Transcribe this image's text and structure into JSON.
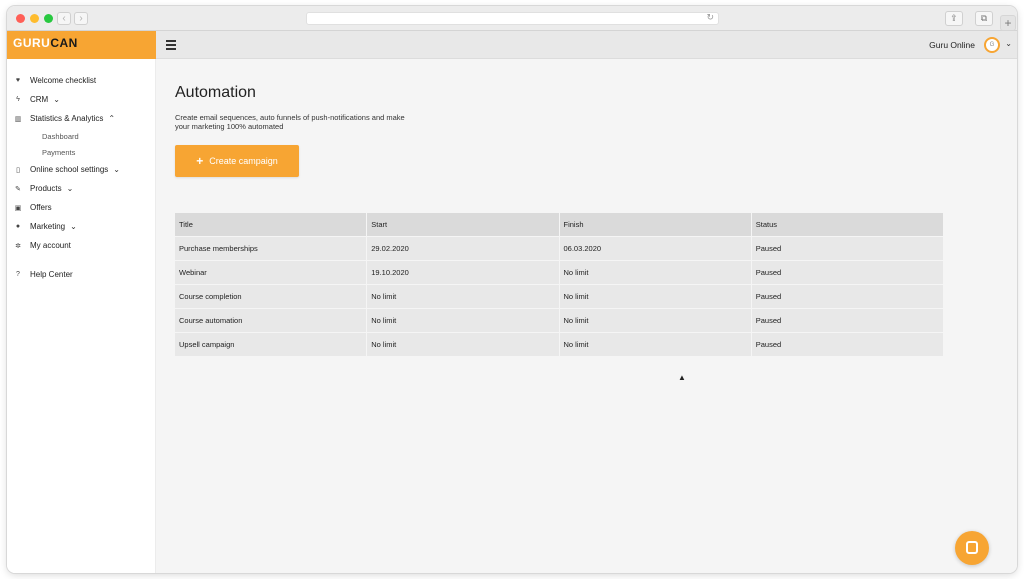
{
  "browser": {
    "back_glyph": "‹",
    "forward_glyph": "›",
    "reload_glyph": "↻",
    "share_glyph": "⇪",
    "tabs_glyph": "⧉",
    "new_tab_glyph": "+"
  },
  "brand": {
    "logo_left": "GURU",
    "logo_right": "CAN",
    "accent_color": "#f7a533"
  },
  "sidebar": {
    "items": [
      {
        "label": "Welcome checklist",
        "icon": "heart-icon",
        "glyph": "♥",
        "chevron": ""
      },
      {
        "label": "CRM",
        "icon": "bolt-icon",
        "glyph": "ϟ",
        "chevron": "⌄"
      },
      {
        "label": "Statistics & Analytics",
        "icon": "chart-icon",
        "glyph": "▥",
        "chevron": "⌃"
      },
      {
        "label": "Online school settings",
        "icon": "phone-icon",
        "glyph": "▯",
        "chevron": "⌄"
      },
      {
        "label": "Products",
        "icon": "pencil-icon",
        "glyph": "✎",
        "chevron": "⌄"
      },
      {
        "label": "Offers",
        "icon": "ticket-icon",
        "glyph": "▣",
        "chevron": ""
      },
      {
        "label": "Marketing",
        "icon": "chat-bubble-icon",
        "glyph": "●",
        "chevron": "⌄"
      },
      {
        "label": "My account",
        "icon": "gear-icon",
        "glyph": "✲",
        "chevron": ""
      }
    ],
    "sub_items": [
      "Dashboard",
      "Payments"
    ],
    "help": {
      "label": "Help Center",
      "icon": "question-icon",
      "glyph": "?"
    }
  },
  "header": {
    "user_name": "Guru Online",
    "avatar_text": "G",
    "chevron": "⌄"
  },
  "main": {
    "title": "Automation",
    "description": "Create email sequences, auto funnels of push-notifications and make your marketing 100% automated",
    "create_button": "Create campaign",
    "create_button_icon": "+"
  },
  "table": {
    "columns": [
      "Title",
      "Start",
      "Finish",
      "Status"
    ],
    "rows": [
      [
        "Purchase memberships",
        "29.02.2020",
        "06.03.2020",
        "Paused"
      ],
      [
        "Webinar",
        "19.10.2020",
        "No limit",
        "Paused"
      ],
      [
        "Course completion",
        "No limit",
        "No limit",
        "Paused"
      ],
      [
        "Course automation",
        "No limit",
        "No limit",
        "Paused"
      ],
      [
        "Upsell campaign",
        "No limit",
        "No limit",
        "Paused"
      ]
    ]
  }
}
